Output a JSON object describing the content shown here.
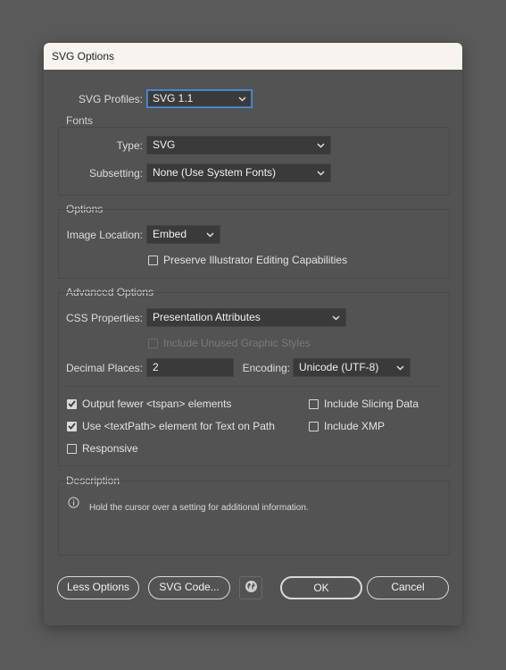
{
  "dialog": {
    "title": "SVG Options"
  },
  "profiles": {
    "label": "SVG Profiles:",
    "value": "SVG 1.1"
  },
  "fonts": {
    "group_title": "Fonts",
    "type_label": "Type:",
    "type_value": "SVG",
    "subsetting_label": "Subsetting:",
    "subsetting_value": "None (Use System Fonts)"
  },
  "options": {
    "group_title": "Options",
    "image_location_label": "Image Location:",
    "image_location_value": "Embed",
    "preserve_label": "Preserve Illustrator Editing Capabilities",
    "preserve_checked": false
  },
  "advanced": {
    "group_title": "Advanced Options",
    "css_label": "CSS Properties:",
    "css_value": "Presentation Attributes",
    "unused_styles_label": "Include Unused Graphic Styles",
    "decimal_label": "Decimal Places:",
    "decimal_value": "2",
    "encoding_label": "Encoding:",
    "encoding_value": "Unicode (UTF-8)",
    "tspan_label": "Output fewer <tspan> elements",
    "textpath_label": "Use <textPath> element for Text on Path",
    "responsive_label": "Responsive",
    "slicing_label": "Include Slicing Data",
    "xmp_label": "Include XMP"
  },
  "description": {
    "group_title": "Description",
    "text": "Hold the cursor over a setting for additional information.",
    "icon": "info-icon"
  },
  "buttons": {
    "less_options": "Less Options",
    "svg_code": "SVG Code...",
    "web_icon": "globe-icon",
    "ok": "OK",
    "cancel": "Cancel"
  },
  "colors": {
    "background": "#5a5a5a",
    "dialog": "#535353",
    "titlebar": "#f7f4ef",
    "field": "#3a3a3a",
    "focus": "#4a8fd8"
  }
}
